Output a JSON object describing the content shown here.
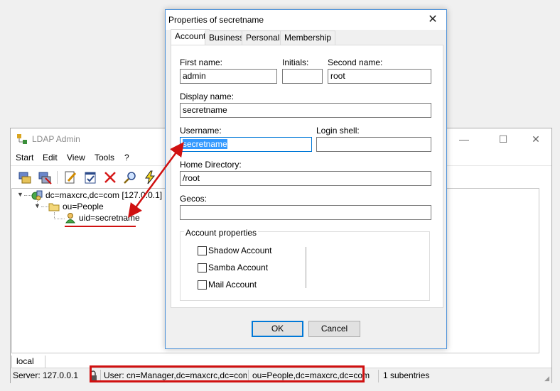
{
  "main_window": {
    "title": "LDAP Admin",
    "menu": [
      "Start",
      "Edit",
      "View",
      "Tools",
      "?"
    ],
    "toolbar_icons": [
      "connect-icon",
      "disconnect-icon",
      "edit-entry-icon",
      "properties-icon",
      "delete-icon",
      "search-icon",
      "lightning-icon"
    ],
    "tree": {
      "root": "dc=maxcrc,dc=com [127.0.0.1]",
      "ou": "ou=People",
      "uid": "uid=secretname"
    },
    "bottom_tab": "local",
    "status": {
      "server": "Server: 127.0.0.1",
      "user": "User: cn=Manager,dc=maxcrc,dc=com",
      "path": "ou=People,dc=maxcrc,dc=com",
      "subentries": "1 subentries"
    }
  },
  "dialog": {
    "title": "Properties of secretname",
    "tabs": [
      "Account",
      "Business",
      "Personal",
      "Membership"
    ],
    "active_tab": "Account",
    "labels": {
      "first_name": "First name:",
      "initials": "Initials:",
      "second_name": "Second name:",
      "display_name": "Display name:",
      "username": "Username:",
      "login_shell": "Login shell:",
      "home_directory": "Home Directory:",
      "gecos": "Gecos:"
    },
    "values": {
      "first_name": "admin",
      "initials": "",
      "second_name": "root",
      "display_name": "secretname",
      "username": "secretname",
      "login_shell": "",
      "home_directory": "/root",
      "gecos": ""
    },
    "account_properties": {
      "title": "Account properties",
      "checkboxes": [
        {
          "label": "Shadow Account",
          "checked": false
        },
        {
          "label": "Samba Account",
          "checked": false
        },
        {
          "label": "Mail Account",
          "checked": false
        }
      ]
    },
    "ok_label": "OK",
    "cancel_label": "Cancel"
  },
  "annotation_color": "#d01010"
}
